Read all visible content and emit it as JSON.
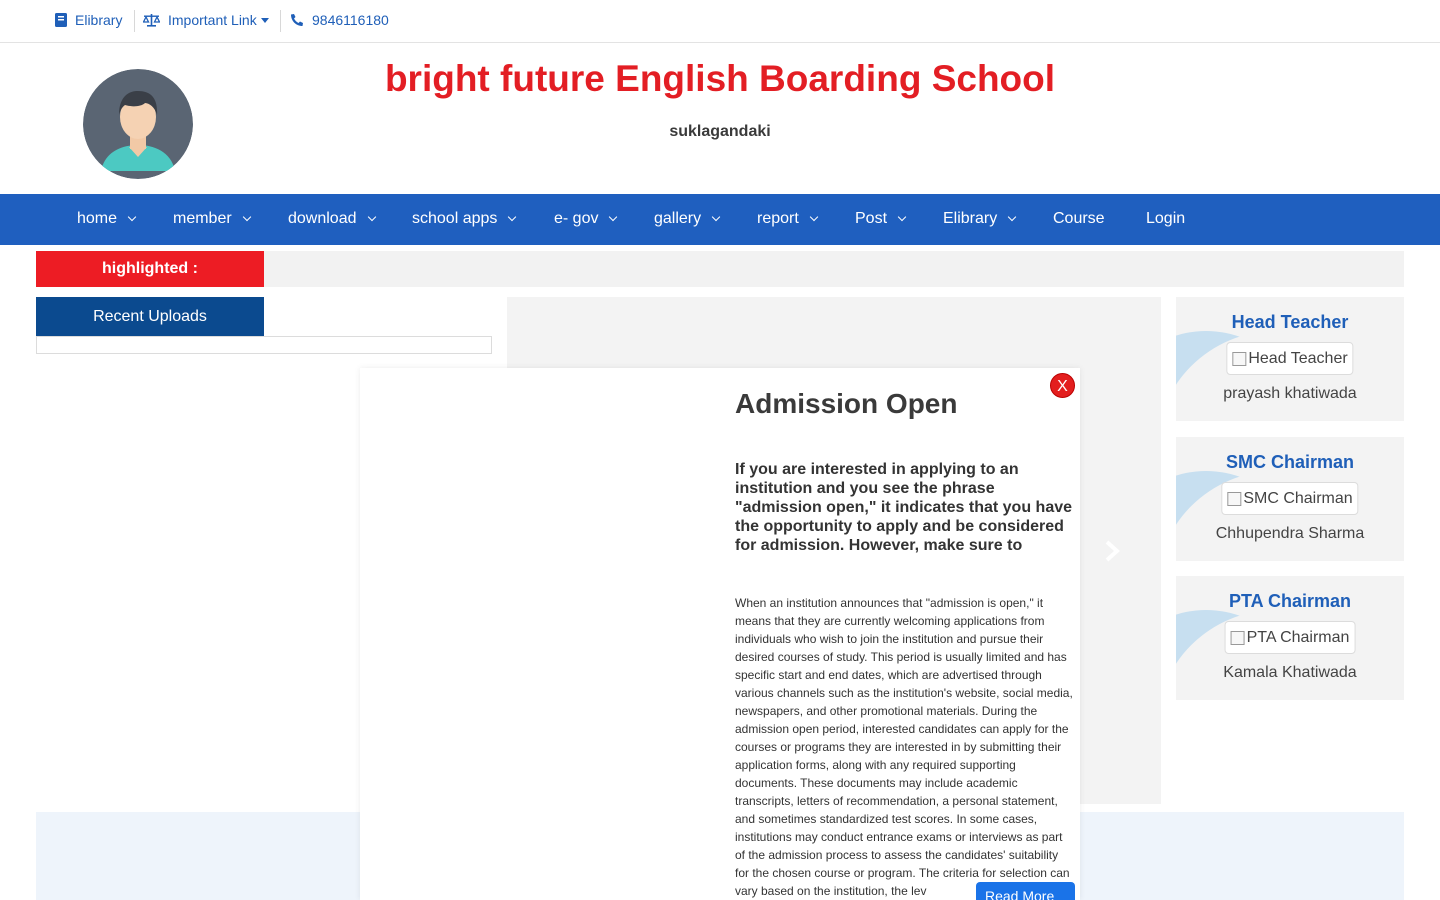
{
  "topbar": {
    "elibrary": "Elibrary",
    "important_link": "Important Link",
    "phone": "9846116180"
  },
  "header": {
    "school_name": "bright future English Boarding School",
    "subtitle": "suklagandaki"
  },
  "nav": {
    "items": [
      {
        "label": "home"
      },
      {
        "label": "member"
      },
      {
        "label": "download"
      },
      {
        "label": "school apps"
      },
      {
        "label": "e- gov"
      },
      {
        "label": "gallery"
      },
      {
        "label": "report"
      },
      {
        "label": "Post"
      },
      {
        "label": "Elibrary"
      },
      {
        "label": "Course"
      },
      {
        "label": "Login"
      }
    ]
  },
  "highlight": {
    "label": "highlighted :"
  },
  "recent": {
    "title": "Recent Uploads"
  },
  "cards": [
    {
      "title": "Head Teacher",
      "img_alt": "Head Teacher",
      "name": "prayash khatiwada"
    },
    {
      "title": "SMC Chairman",
      "img_alt": "SMC Chairman",
      "name": "Chhupendra Sharma"
    },
    {
      "title": "PTA Chairman",
      "img_alt": "PTA Chairman",
      "name": "Kamala Khatiwada"
    }
  ],
  "modal": {
    "close": "X",
    "title": "Admission Open",
    "lead": "If you are interested in applying to an institution and you see the phrase \"admission open,\" it indicates that you have the opportunity to apply and be considered for admission. However, make sure to",
    "body": "When an institution announces that \"admission is open,\" it means that they are currently welcoming applications from individuals who wish to join the institution and pursue their desired courses of study. This period is usually limited and has specific start and end dates, which are advertised through various channels such as the institution's website, social media, newspapers, and other promotional materials. During the admission open period, interested candidates can apply for the courses or programs they are interested in by submitting their application forms, along with any required supporting documents. These documents may include academic transcripts, letters of recommendation, a personal statement, and sometimes standardized test scores. In some cases, institutions may conduct entrance exams or interviews as part of the admission process to assess the candidates' suitability for the chosen course or program. The criteria for selection can vary based on the institution, the lev",
    "read_more": "Read More"
  },
  "colors": {
    "brand_blue": "#1f5fbf",
    "title_red": "#e31e24",
    "dark_blue": "#0b4a8f"
  }
}
